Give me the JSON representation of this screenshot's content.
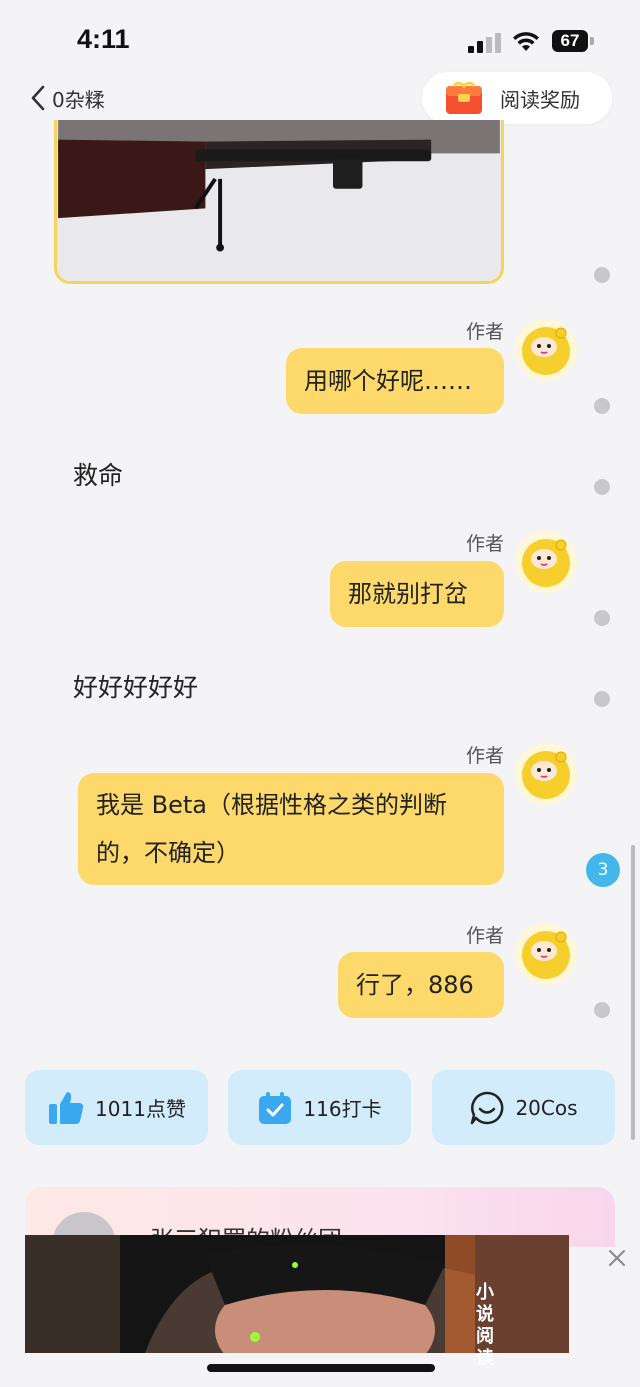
{
  "status": {
    "time": "4:11",
    "battery": "67"
  },
  "nav": {
    "back_label": "0杂糅",
    "reward_label": "阅读奖励"
  },
  "messages": [
    {
      "tag": "作者",
      "text": "用哪个好呢……"
    },
    {
      "text": "救命"
    },
    {
      "tag": "作者",
      "text": "那就别打岔"
    },
    {
      "text": "好好好好好"
    },
    {
      "tag": "作者",
      "line1": "我是 Beta（根据性格之类的判断",
      "line2": "的，不确定）"
    },
    {
      "tag": "作者",
      "text": "行了，886"
    }
  ],
  "badge_count": "3",
  "actions": {
    "like": "1011点赞",
    "checkin": "116打卡",
    "comment": "20Cos"
  },
  "fan_card": {
    "title": "张三犯罪的粉丝团"
  },
  "ad": {
    "text": "小说阅读"
  },
  "colors": {
    "bubble": "#fcd96a",
    "action_bg": "#d2ecfb",
    "icon_blue": "#3aa8ee",
    "badge": "#44b7ea"
  }
}
